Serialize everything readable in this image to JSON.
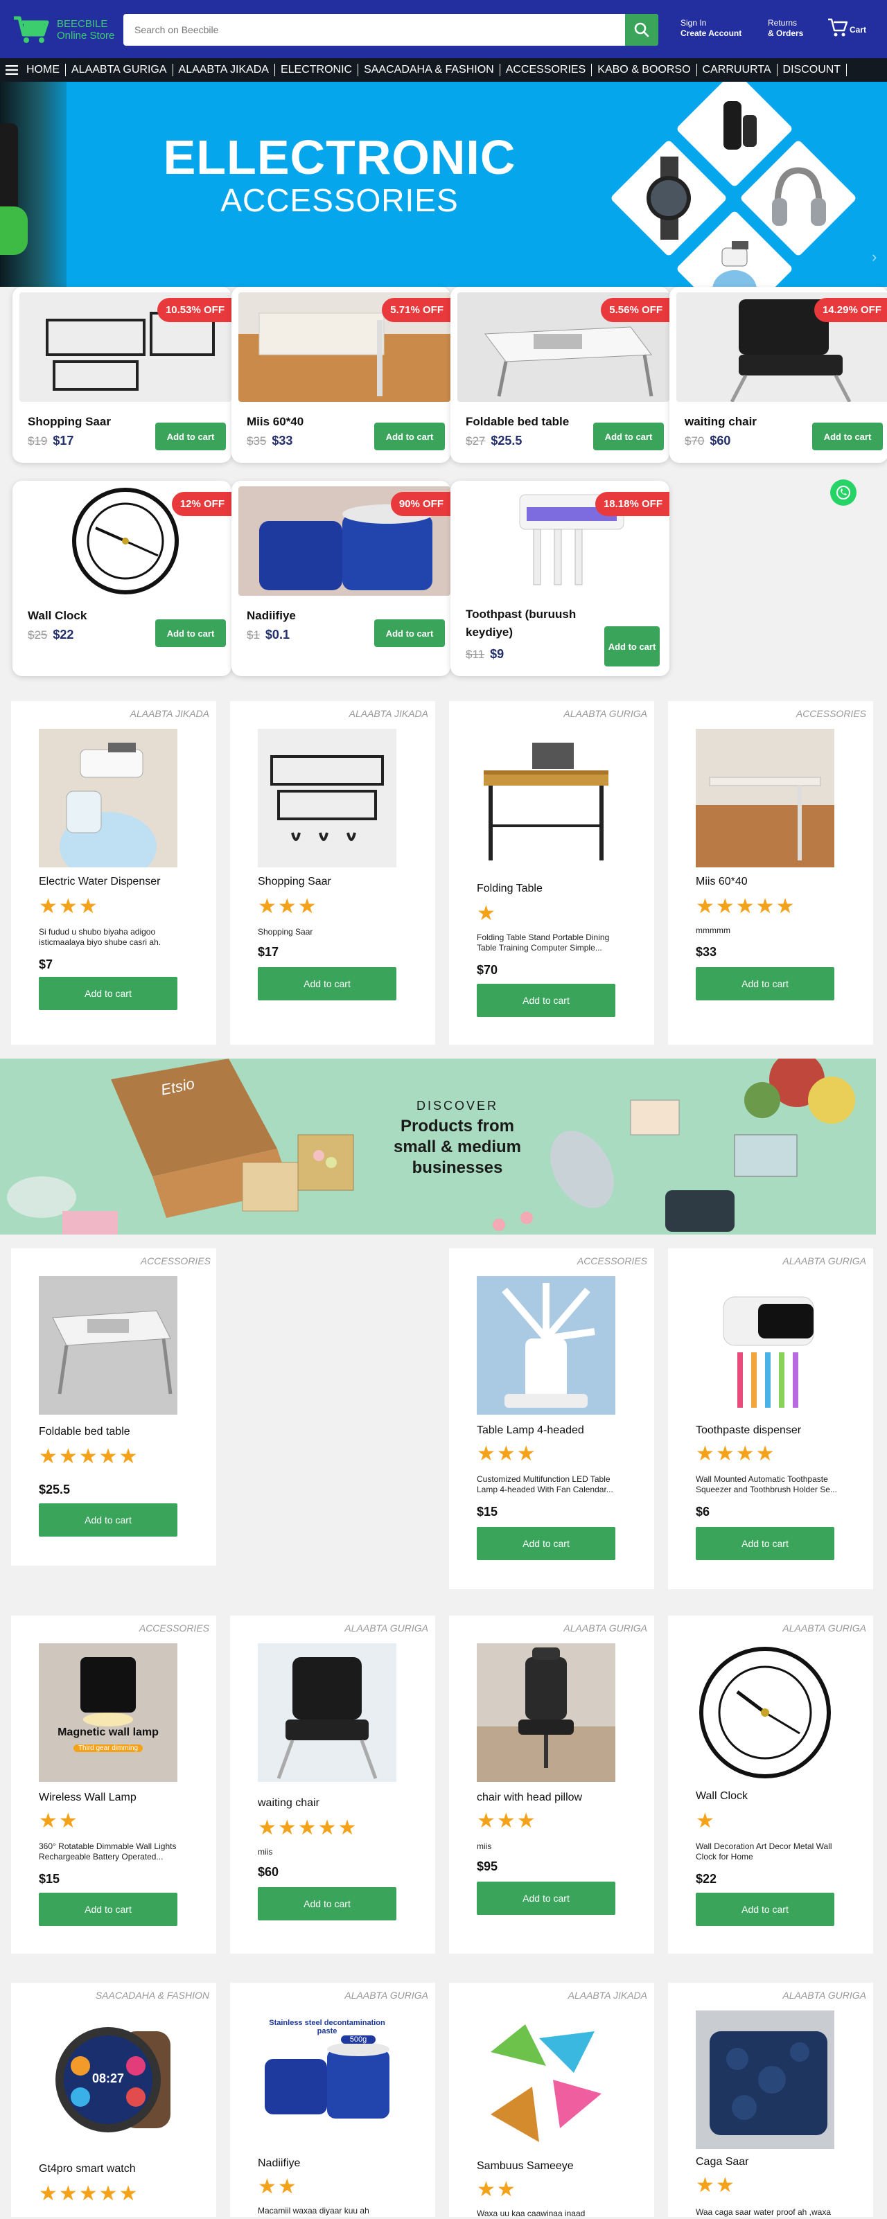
{
  "header": {
    "logo_line1": "BEECBILE",
    "logo_line2": "Online Store",
    "search_placeholder": "Search on Beecbile",
    "signin_line1": "Sign In",
    "signin_line2": "Create Account",
    "returns_line1": "Returns",
    "returns_line2": "& Orders",
    "cart_label": "Cart"
  },
  "nav": [
    "HOME",
    "ALAABTA GURIGA",
    "ALAABTA JIKADA",
    "ELECTRONIC",
    "SAACADAHA & FASHION",
    "ACCESSORIES",
    "KABO & BOORSO",
    "CARRUURTA",
    "DISCOUNT"
  ],
  "banner": {
    "line1": "ELLECTRONIC",
    "line2": "ACCESSORIES"
  },
  "deals": [
    {
      "name": "Shopping Saar",
      "old": "$19",
      "price": "$17",
      "badge": "10.53% OFF",
      "btn": "Add to cart"
    },
    {
      "name": "Miis 60*40",
      "old": "$35",
      "price": "$33",
      "badge": "5.71% OFF",
      "btn": "Add to cart"
    },
    {
      "name": "Foldable bed table",
      "old": "$27",
      "price": "$25.5",
      "badge": "5.56% OFF",
      "btn": "Add to cart"
    },
    {
      "name": "waiting chair",
      "old": "$70",
      "price": "$60",
      "badge": "14.29% OFF",
      "btn": "Add to cart"
    },
    {
      "name": "Wall Clock",
      "old": "$25",
      "price": "$22",
      "badge": "12% OFF",
      "btn": "Add to cart"
    },
    {
      "name": "Nadiifiye",
      "old": "$1",
      "price": "$0.1",
      "badge": "90% OFF",
      "btn": "Add to cart"
    },
    {
      "name": "Toothpast (buruush keydiye)",
      "old": "$11",
      "price": "$9",
      "badge": "18.18% OFF",
      "btn": "Add to cart"
    }
  ],
  "products": [
    {
      "cat": "ALAABTA JIKADA",
      "name": "Electric Water Dispenser",
      "rating": 3,
      "desc": "Si fudud u shubo biyaha adigoo isticmaalaya biyo shube casri ah.",
      "price": "$7",
      "btn": "Add to cart"
    },
    {
      "cat": "ALAABTA JIKADA",
      "name": "Shopping Saar",
      "rating": 3,
      "desc": "Shopping Saar",
      "price": "$17",
      "btn": "Add to cart"
    },
    {
      "cat": "ALAABTA GURIGA",
      "name": "Folding Table",
      "rating": 1,
      "desc": "Folding Table Stand Portable Dining Table Training Computer Simple...",
      "price": "$70",
      "btn": "Add to cart"
    },
    {
      "cat": "ACCESSORIES",
      "name": "Miis 60*40",
      "rating": 5,
      "desc": "mmmmm",
      "price": "$33",
      "btn": "Add to cart"
    },
    {
      "cat": "ACCESSORIES",
      "name": "Foldable bed table",
      "rating": 5,
      "desc": "",
      "price": "$25.5",
      "btn": "Add to cart"
    },
    {
      "cat": "ACCESSORIES",
      "name": "Table Lamp 4-headed",
      "rating": 3,
      "desc": "Customized Multifunction LED Table Lamp 4-headed With Fan Calendar...",
      "price": "$15",
      "btn": "Add to cart"
    },
    {
      "cat": "ALAABTA GURIGA",
      "name": "Toothpaste dispenser",
      "rating": 4,
      "desc": "Wall Mounted Automatic Toothpaste Squeezer and Toothbrush Holder Se...",
      "price": "$6",
      "btn": "Add to cart"
    },
    {
      "cat": "ACCESSORIES",
      "name": "Wireless Wall Lamp",
      "rating": 2,
      "desc": "360° Rotatable Dimmable Wall Lights Rechargeable Battery Operated...",
      "price": "$15",
      "btn": "Add to cart"
    },
    {
      "cat": "ALAABTA GURIGA",
      "name": "waiting chair",
      "rating": 5,
      "desc": "miis",
      "price": "$60",
      "btn": "Add to cart"
    },
    {
      "cat": "ALAABTA GURIGA",
      "name": "chair with head pillow",
      "rating": 3,
      "desc": "miis",
      "price": "$95",
      "btn": "Add to cart"
    },
    {
      "cat": "ALAABTA GURIGA",
      "name": "Wall Clock",
      "rating": 1,
      "desc": "Wall Decoration Art Decor Metal Wall Clock for Home",
      "price": "$22",
      "btn": "Add to cart"
    },
    {
      "cat": "SAACADAHA & FASHION",
      "name": "Gt4pro smart watch",
      "rating": 5,
      "desc": "",
      "price": "",
      "btn": ""
    },
    {
      "cat": "ALAABTA GURIGA",
      "name": "Nadiifiye",
      "rating": 2,
      "desc": "Macamiil waxaa diyaar kuu ah",
      "price": "",
      "btn": ""
    },
    {
      "cat": "ALAABTA JIKADA",
      "name": "Sambuus Sameeye",
      "rating": 2,
      "desc": "Waxa uu kaa caawinaa inaad",
      "price": "",
      "btn": ""
    },
    {
      "cat": "ALAABTA GURIGA",
      "name": "Caga Saar",
      "rating": 2,
      "desc": "Waa caga saar water proof ah ,waxa",
      "price": "",
      "btn": ""
    }
  ],
  "promo": {
    "kicker": "DISCOVER",
    "text": "Products from small & medium businesses",
    "brand": "Etsio"
  },
  "smartwatch_time": "08:27",
  "product_label_lamp": "Magnetic wall lamp",
  "product_label_lamp2": "Third gear dimming",
  "product_label_cleaner": "Stainless steel decontamination paste",
  "product_label_cleaner2": "500g",
  "colors": {
    "header": "#232f9f",
    "nav": "#131921",
    "accent": "#3aa45b",
    "badge": "#e8393c",
    "star": "#f5a21b",
    "banner": "#06a6ec"
  },
  "icons": [
    "cart-logo-icon",
    "search-icon",
    "cart-icon",
    "menu-icon",
    "whatsapp-icon",
    "chevron-right-icon"
  ]
}
